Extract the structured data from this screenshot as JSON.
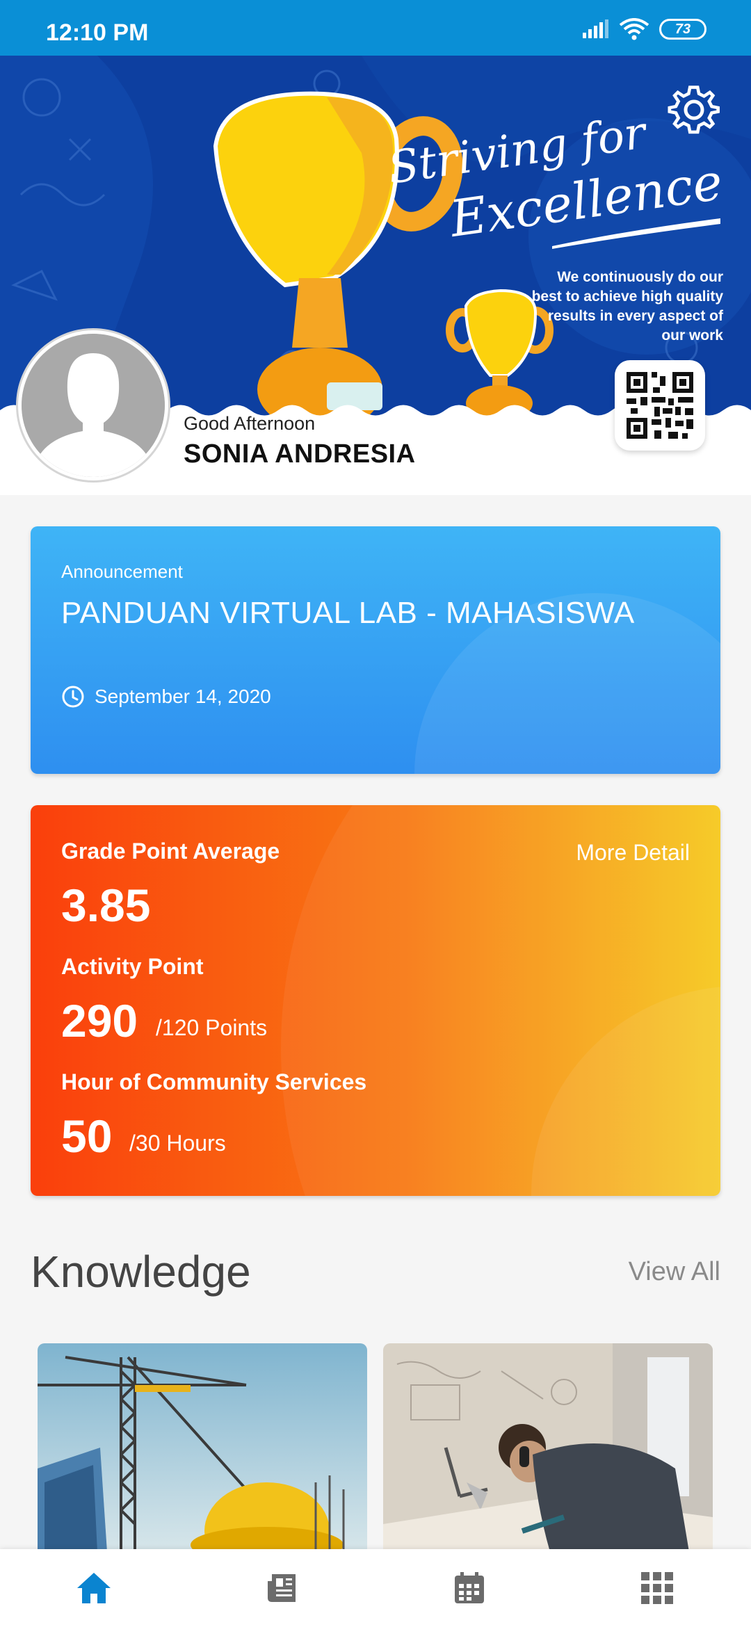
{
  "status_bar": {
    "time": "12:10 PM",
    "battery": "73"
  },
  "banner": {
    "slogan_line1": "Striving for",
    "slogan_line2": "Excellence",
    "tagline": "We continuously do our best to achieve high quality results in every aspect of our work"
  },
  "profile": {
    "greeting": "Good Afternoon",
    "name": "SONIA ANDRESIA"
  },
  "announcement": {
    "label": "Announcement",
    "title": "PANDUAN VIRTUAL LAB - MAHASISWA",
    "date": "September 14, 2020"
  },
  "stats": {
    "gpa_label": "Grade Point Average",
    "gpa_value": "3.85",
    "more_detail": "More Detail",
    "activity_label": "Activity Point",
    "activity_value": "290",
    "activity_target": "/120 Points",
    "community_label": "Hour of Community Services",
    "community_value": "50",
    "community_target": "/30 Hours"
  },
  "knowledge": {
    "title": "Knowledge",
    "view_all": "View All"
  },
  "nav": {
    "items": [
      {
        "icon": "home-icon",
        "active": true
      },
      {
        "icon": "news-icon",
        "active": false
      },
      {
        "icon": "calendar-icon",
        "active": false
      },
      {
        "icon": "apps-grid-icon",
        "active": false
      }
    ],
    "active_color": "#0a84d0",
    "inactive_color": "#6b6b6b"
  },
  "colors": {
    "status_bar": "#0a8fd6",
    "banner": "#0d3fa0",
    "announcement": "#2e8ff0",
    "stats_start": "#fa3f0c",
    "stats_end": "#f6c81c"
  }
}
